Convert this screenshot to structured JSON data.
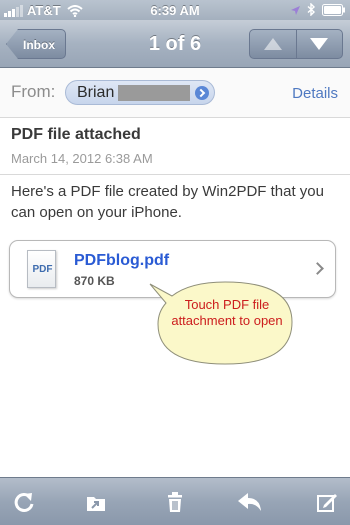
{
  "status_bar": {
    "carrier": "AT&T",
    "time": "6:39 AM"
  },
  "nav": {
    "back_label": "Inbox",
    "title": "1 of 6",
    "prev_icon": "up-arrow-icon",
    "next_icon": "down-arrow-icon"
  },
  "header": {
    "from_label": "From:",
    "sender_name": "Brian",
    "details_label": "Details"
  },
  "message": {
    "subject": "PDF file attached",
    "date": "March 14, 2012 6:38 AM",
    "body": "Here's a PDF file created by Win2PDF that you can open on your iPhone."
  },
  "attachment": {
    "icon_label": "PDF",
    "file_name": "PDFblog.pdf",
    "file_size": "870 KB"
  },
  "callout": {
    "text": "Touch PDF file attachment to open"
  },
  "toolbar": {
    "icons": [
      "refresh-icon",
      "move-to-folder-icon",
      "trash-icon",
      "reply-icon",
      "compose-icon"
    ]
  },
  "colors": {
    "link_blue": "#2a5bd4",
    "details_blue": "#4f79c1",
    "callout_fill": "#fbf8c9",
    "callout_text": "#cc1d1d"
  }
}
